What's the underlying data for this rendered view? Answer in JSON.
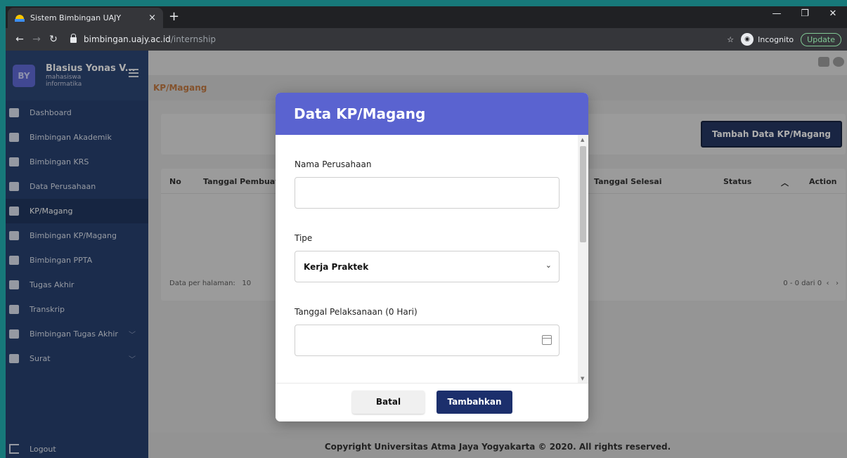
{
  "browser": {
    "tab_title": "Sistem Bimbingan UAJY",
    "tab_close": "×",
    "new_tab": "+",
    "url_host": "bimbingan.uajy.ac.id",
    "url_path": "/internship",
    "incognito_label": "Incognito",
    "update_label": "Update"
  },
  "sidebar": {
    "avatar_initials": "BY",
    "user_name": "Blasius Yonas V...",
    "user_role": "mahasiswa",
    "user_dept": "informatika",
    "items": [
      {
        "label": "Dashboard"
      },
      {
        "label": "Bimbingan Akademik"
      },
      {
        "label": "Bimbingan KRS"
      },
      {
        "label": "Data Perusahaan"
      },
      {
        "label": "KP/Magang"
      },
      {
        "label": "Bimbingan KP/Magang"
      },
      {
        "label": "Bimbingan PPTA"
      },
      {
        "label": "Tugas Akhir"
      },
      {
        "label": "Transkrip"
      },
      {
        "label": "Bimbingan Tugas Akhir"
      },
      {
        "label": "Surat"
      }
    ],
    "logout": "Logout"
  },
  "main": {
    "breadcrumb": "KP/Magang",
    "add_button": "Tambah Data KP/Magang",
    "columns": {
      "no": "No",
      "tanggal_pembuatan": "Tanggal Pembuata",
      "tanggal_selesai": "Tanggal Selesai",
      "status": "Status",
      "action": "Action"
    },
    "per_page_label": "Data per halaman:",
    "per_page_value": "10",
    "range_label": "0 - 0 dari 0",
    "footer": "Copyright Universitas Atma Jaya Yogyakarta © 2020. All rights reserved."
  },
  "modal": {
    "title": "Data KP/Magang",
    "company_label": "Nama Perusahaan",
    "company_value": "",
    "type_label": "Tipe",
    "type_value": "Kerja Praktek",
    "date_label": "Tanggal Pelaksanaan (0 Hari)",
    "date_value": "",
    "cancel_button": "Batal",
    "submit_button": "Tambahkan"
  }
}
